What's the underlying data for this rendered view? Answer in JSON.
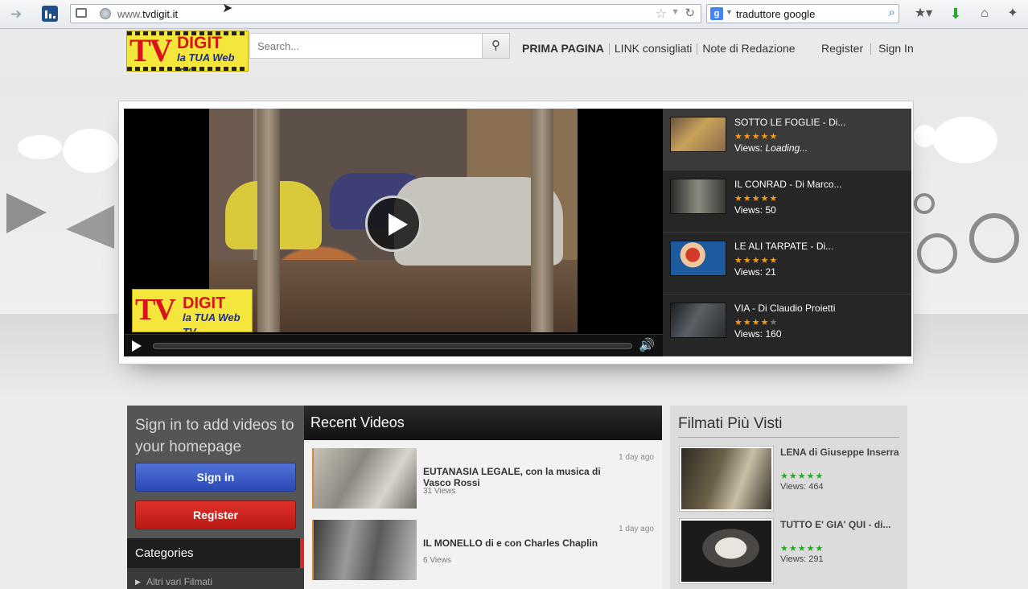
{
  "browser": {
    "url_prefix": "www.",
    "url_domain": "tvdigit.it",
    "search_query": "traduttore google",
    "search_engine_letter": "g"
  },
  "site": {
    "logo_tv": "TV",
    "logo_digit": "DIGIT",
    "logo_sub": "la TUA Web TV",
    "search_placeholder": "Search...",
    "nav": [
      {
        "label": "PRIMA PAGINA"
      },
      {
        "label": "LINK consigliati"
      },
      {
        "label": "Note di Redazione"
      }
    ],
    "account": {
      "register": "Register",
      "sign_in": "Sign In"
    }
  },
  "featured_playlist": [
    {
      "title": "SOTTO LE FOGLIE - Di...",
      "rating": 5,
      "views_label": "Views:",
      "views": "Loading...",
      "active": true
    },
    {
      "title": "IL CONRAD - Di Marco...",
      "rating": 5,
      "views_label": "Views:",
      "views": "50"
    },
    {
      "title": "LE ALI TARPATE - Di...",
      "rating": 5,
      "views_label": "Views:",
      "views": "21"
    },
    {
      "title": "VIA - Di Claudio Proietti",
      "rating": 4,
      "views_label": "Views:",
      "views": "160"
    }
  ],
  "sidebar": {
    "signin_prompt": "Sign in to add videos to your homepage",
    "sign_in_button": "Sign in",
    "register_button": "Register",
    "categories_title": "Categories",
    "categories": [
      "Altri vari Filmati"
    ]
  },
  "recent": {
    "title": "Recent Videos",
    "items": [
      {
        "title": "EUTANASIA LEGALE, con la musica di Vasco Rossi",
        "views": "31 Views",
        "time": "1 day ago"
      },
      {
        "title": "IL MONELLO di e con Charles Chaplin",
        "views": "6 Views",
        "time": "1 day ago"
      }
    ]
  },
  "popular": {
    "title": "Filmati Più Visti",
    "items": [
      {
        "title": "LENA di Giuseppe Inserra",
        "rating": 5,
        "views": "Views: 464"
      },
      {
        "title": "TUTTO E' GIA' QUI - di...",
        "rating": 5,
        "views": "Views: 291"
      }
    ]
  },
  "colors": {
    "accent_red": "#d42a22",
    "signin_blue": "#2a48b3",
    "star_orange": "#f29b1d",
    "star_green": "#2aa62a"
  }
}
